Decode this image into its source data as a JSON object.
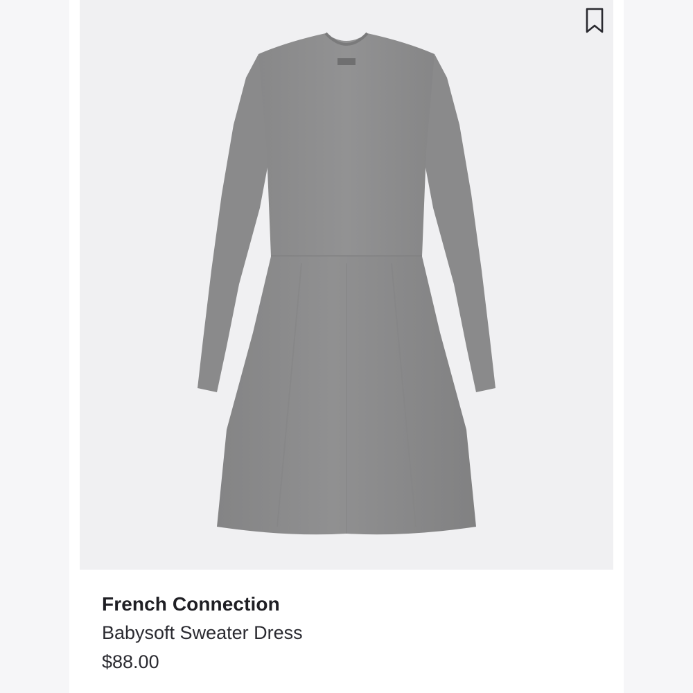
{
  "product": {
    "brand": "French Connection",
    "name": "Babysoft Sweater Dress",
    "price": "$88.00"
  },
  "icons": {
    "bookmark": "bookmark-icon"
  },
  "colors": {
    "dress": "#8c8c8e",
    "image_background": "#f0f0f2",
    "text": "#1f1f24"
  }
}
